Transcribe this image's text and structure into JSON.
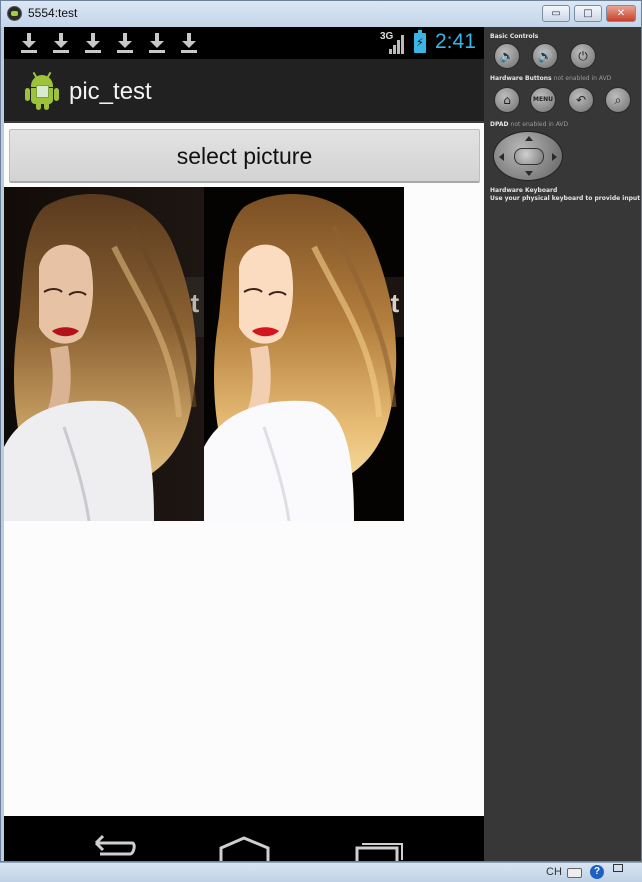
{
  "window": {
    "title": "5554:test",
    "minimize_glyph": "▭",
    "maximize_glyph": "□",
    "close_glyph": "✕"
  },
  "statusbar": {
    "network_type": "3G",
    "time": "2:41",
    "notification_icons": [
      "download-icon",
      "download-icon",
      "download-icon",
      "download-icon",
      "download-icon",
      "download-icon"
    ]
  },
  "app": {
    "title": "pic_test",
    "select_button_label": "select picture"
  },
  "images": [
    {
      "name": "original-picture",
      "description_icon": "photo"
    },
    {
      "name": "brightened-picture",
      "description_icon": "photo"
    }
  ],
  "navbar": {
    "icons": [
      "back-icon",
      "home-icon",
      "recent-apps-icon"
    ]
  },
  "controls": {
    "basic_title": "Basic Controls",
    "hardware_title": "Hardware Buttons",
    "hardware_note": "not enabled in AVD",
    "menu_label": "MENU",
    "dpad_title": "DPAD",
    "dpad_note": "not enabled in AVD",
    "keyboard_title": "Hardware Keyboard",
    "keyboard_note": "Use your physical keyboard to provide input"
  },
  "taskbar": {
    "language": "CH",
    "help_glyph": "?"
  }
}
